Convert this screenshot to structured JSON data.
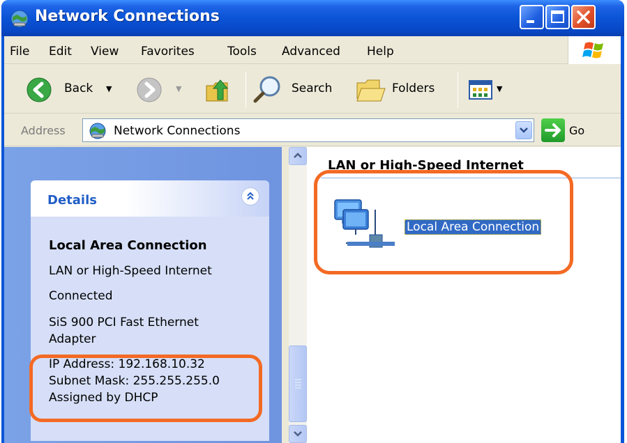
{
  "window": {
    "title": "Network Connections",
    "title_icon": "network-connections-icon",
    "buttons": [
      "minimize",
      "maximize",
      "close"
    ]
  },
  "menu": {
    "items": [
      "File",
      "Edit",
      "View",
      "Favorites",
      "Tools",
      "Advanced",
      "Help"
    ],
    "logo": "windows-flag-icon"
  },
  "toolbar": {
    "back_label": "Back",
    "search_label": "Search",
    "folders_label": "Folders",
    "icons": [
      "back-arrow-icon",
      "forward-arrow-icon",
      "up-folder-icon",
      "search-icon",
      "folders-icon",
      "views-icon"
    ]
  },
  "address": {
    "label": "Address",
    "value": "Network Connections",
    "go_label": "Go"
  },
  "details": {
    "header": "Details",
    "name": "Local Area Connection",
    "type": "LAN or High-Speed Internet",
    "status": "Connected",
    "adapter_line1": "SiS 900 PCI Fast Ethernet",
    "adapter_line2": "Adapter",
    "ip": "IP Address: 192.168.10.32",
    "subnet": "Subnet Mask: 255.255.255.0",
    "assigned": "Assigned by DHCP"
  },
  "content": {
    "group_header": "LAN or High-Speed Internet",
    "connection_label": "Local Area Connection",
    "connection_icon": "lan-connection-icon"
  },
  "colors": {
    "title_bar": "#0a54d6",
    "task_pane": "#7ba2e7",
    "highlight_outline": "#f36a24",
    "selection": "#316ac5"
  }
}
